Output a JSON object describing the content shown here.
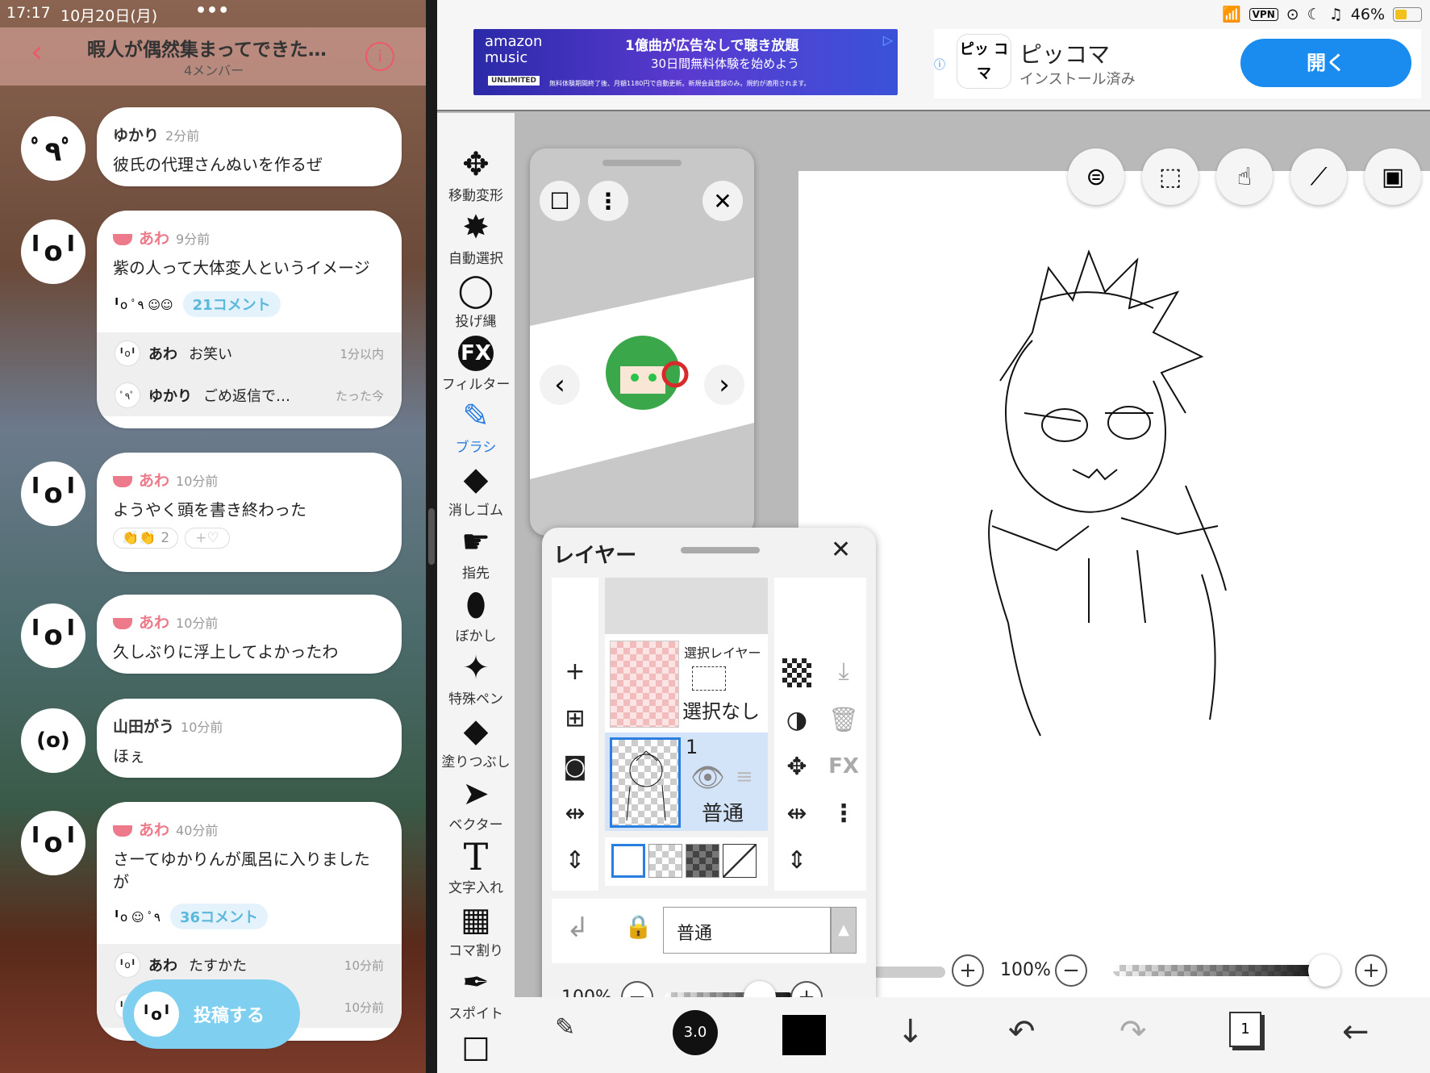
{
  "status_left": {
    "time": "17:17",
    "date": "10月20日(月)",
    "dots": "•••"
  },
  "status_right": {
    "vpn": "VPN",
    "battery": "46%"
  },
  "chat": {
    "title": "暇人が偶然集まってできた…",
    "members": "4メンバー",
    "messages": [
      {
        "user": "ゆかり",
        "time": "2分前",
        "text": "彼氏の代理さんぬいを作るぜ"
      },
      {
        "user": "あわ",
        "time": "9分前",
        "text": "紫の人って大体変人というイメージ",
        "comments": "21コメント",
        "replies": [
          {
            "user": "あわ",
            "text": "お笑い",
            "time": "1分以内"
          },
          {
            "user": "ゆかり",
            "text": "ごめ返信で…",
            "time": "たった今"
          }
        ]
      },
      {
        "user": "あわ",
        "time": "10分前",
        "text": "ようやく頭を書き終わった",
        "reaction_count": "2",
        "reaction_add": "+♡"
      },
      {
        "user": "あわ",
        "time": "10分前",
        "text": "久しぶりに浮上してよかったわ"
      },
      {
        "user": "山田がう",
        "time": "10分前",
        "text": "ほぇ"
      },
      {
        "user": "あわ",
        "time": "40分前",
        "text": "さーてゆかりんが風呂に入りましたが",
        "comments": "36コメント",
        "replies": [
          {
            "user": "あわ",
            "text": "たすかた",
            "time": "10分前"
          },
          {
            "user": "",
            "text": "",
            "time": "10分前"
          }
        ]
      }
    ],
    "post_button": "投稿する"
  },
  "ad": {
    "amazon_logo": "amazon music",
    "amazon_badge": "UNLIMITED",
    "amazon_headline": "1億曲が広告なしで聴き放題",
    "amazon_sub": "30日間無料体験を始めよう",
    "amazon_fine": "無料体験期間終了後、月額1180円で自動更新。新規会員登録のみ。規約が適用されます。",
    "app_icon": "ピッ コマ",
    "app_name": "ピッコマ",
    "app_status": "インストール済み",
    "open_button": "開く"
  },
  "tools": [
    {
      "label": "移動変形",
      "icon": "✥"
    },
    {
      "label": "自動選択",
      "icon": "✸"
    },
    {
      "label": "投げ縄",
      "icon": "◯"
    },
    {
      "label": "フィルター",
      "icon": "FX"
    },
    {
      "label": "ブラシ",
      "icon": "✎",
      "active": true
    },
    {
      "label": "消しゴム",
      "icon": "◆"
    },
    {
      "label": "指先",
      "icon": "☛"
    },
    {
      "label": "ぼかし",
      "icon": "💧"
    },
    {
      "label": "特殊ペン",
      "icon": "✦"
    },
    {
      "label": "塗りつぶし",
      "icon": "◆"
    },
    {
      "label": "ベクター",
      "icon": "➤"
    },
    {
      "label": "文字入れ",
      "icon": "T"
    },
    {
      "label": "コマ割り",
      "icon": "▦"
    },
    {
      "label": "スポイト",
      "icon": "✒"
    }
  ],
  "layers_panel": {
    "title": "レイヤー",
    "selection_layer": "選択レイヤー",
    "no_selection": "選択なし",
    "layer_number": "1",
    "layer_mode": "普通",
    "blend_mode": "普通",
    "opacity": "100%",
    "fx": "FX",
    "brush_size_hint": "3.0px"
  },
  "canvas": {
    "zoom": "100%",
    "brush_size": "3.0"
  },
  "page_indicator": "1",
  "colors": {
    "accent": "#2a7de1",
    "pink": "#ec7a8a",
    "comment": "#5ab8dc",
    "post": "#7fcff0",
    "open_btn": "#1a8cf0"
  }
}
